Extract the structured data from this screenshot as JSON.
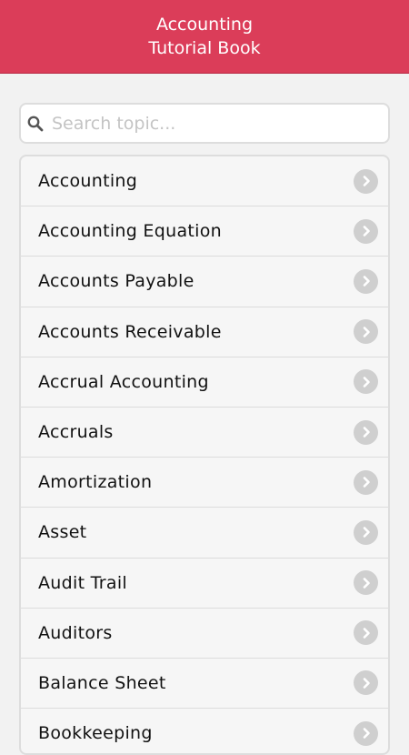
{
  "header": {
    "title": "Accounting\nTutorial Book"
  },
  "search": {
    "placeholder": "Search topic..."
  },
  "topics": [
    "Accounting",
    "Accounting Equation",
    "Accounts Payable",
    "Accounts Receivable",
    "Accrual Accounting",
    "Accruals",
    "Amortization",
    "Asset",
    "Audit Trail",
    "Auditors",
    "Balance Sheet",
    "Bookkeeping"
  ],
  "colors": {
    "header_bg": "#db3d59",
    "chevron_bg": "#cfcfcf"
  },
  "icons": {
    "search": "search-icon",
    "row_arrow": "chevron-right-icon"
  }
}
